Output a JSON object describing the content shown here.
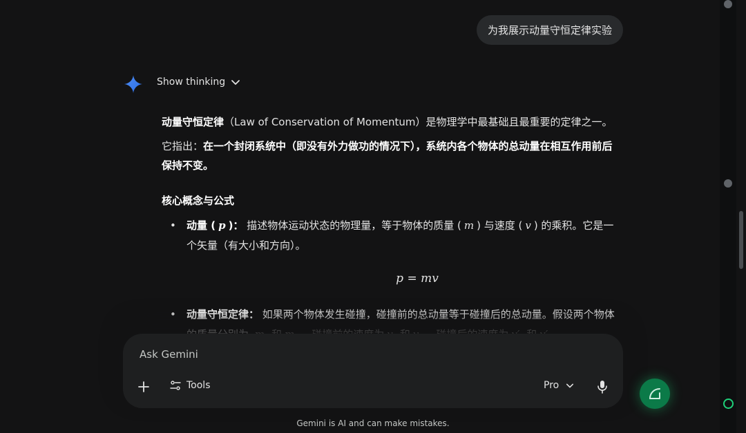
{
  "user_message": "为我展示动量守恒定律实验",
  "thinking_toggle": "Show thinking",
  "response": {
    "intro_term": "动量守恒定律",
    "intro_rest": "（Law of Conservation of Momentum）是物理学中最基础且最重要的定律之一。",
    "statement_prefix": "它指出：",
    "statement_bold": "在一个封闭系统中（即没有外力做功的情况下），系统内各个物体的总动量在相互作用前后保持不变。",
    "section_title": "核心概念与公式",
    "bullet1": {
      "term": "动量 (",
      "sym": "p",
      "term_end": ")：",
      "text_a": "描述物体运动状态的物理量，等于物体的质量 (",
      "m": "m",
      "text_b": ") 与速度 (",
      "v": "v",
      "text_c": ") 的乘积。它是一个矢量（有大小和方向）。"
    },
    "formula": "p = mv",
    "bullet2": {
      "term": "动量守恒定律：",
      "text": "如果两个物体发生碰撞，碰撞前的总动量等于碰撞后的总动量。假设两个物体的质量分别为",
      "m1": "m₁",
      "and1": "和",
      "m2": "m₂",
      "text2": "，碰撞前的速度为",
      "v1": "v₁",
      "and2": "和",
      "v2": "v₂",
      "text3": "，碰撞后的速度为",
      "v1p": "v′₁",
      "and3": "和",
      "v2p": "v′₂"
    }
  },
  "input": {
    "placeholder": "Ask Gemini",
    "tools_label": "Tools",
    "model_label": "Pro"
  },
  "disclaimer": "Gemini is AI and can make mistakes.",
  "colors": {
    "background": "#131314",
    "bubble": "#282a2c",
    "input_bg": "#1e1f20",
    "fab": "#0b7a48",
    "accent_green": "#1fd17a"
  },
  "icons": [
    "gemini-star-icon",
    "chevron-down-icon",
    "plus-icon",
    "tools-icon",
    "mic-icon",
    "compose-icon"
  ]
}
